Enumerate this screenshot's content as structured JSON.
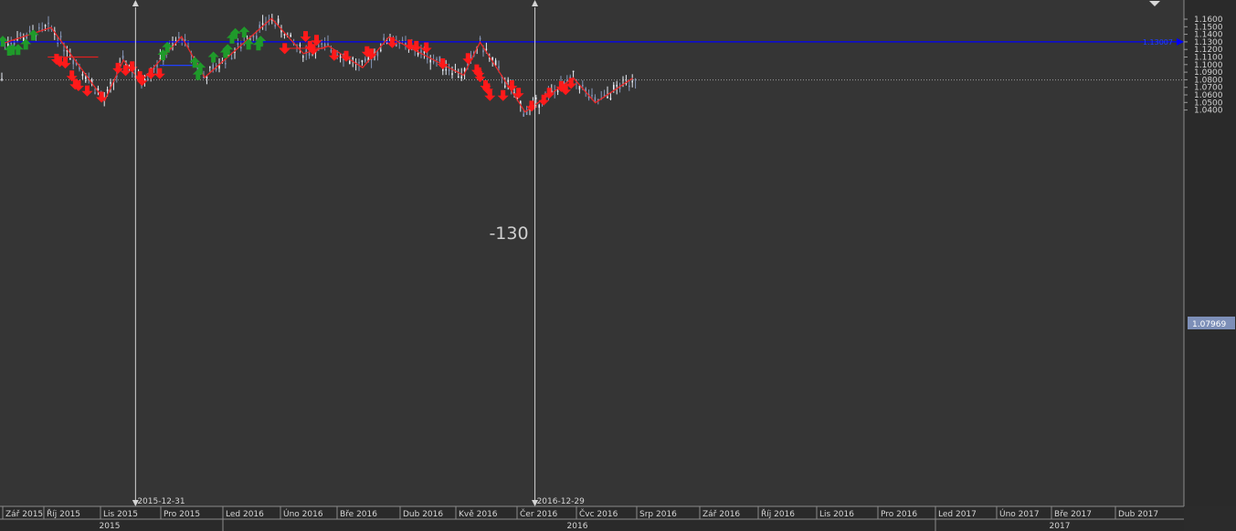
{
  "chart_data": {
    "type": "candlestick",
    "instrument_hint": "EUR/USD-style price series",
    "y_axis": {
      "ticks": [
        1.16,
        1.15,
        1.14,
        1.13,
        1.12,
        1.11,
        1.1,
        1.09,
        1.08,
        1.07,
        1.06,
        1.05,
        1.04
      ],
      "tick_labels": [
        "1.1600",
        "1.1500",
        "1.1400",
        "1.1300",
        "1.1200",
        "1.1100",
        "1.1000",
        "1.0900",
        "1.0800",
        "1.0700",
        "1.0600",
        "1.0500",
        "1.0400"
      ],
      "range": [
        1.033,
        1.1655
      ]
    },
    "x_axis": {
      "month_labels": [
        "Zář 2015",
        "Říj 2015",
        "Lis 2015",
        "Pro 2015",
        "Led 2016",
        "Úno 2016",
        "Bře 2016",
        "Dub 2016",
        "Kvě 2016",
        "Čer 2016",
        "Čvc 2016",
        "Srp 2016",
        "Zář 2016",
        "Říj 2016",
        "Lis 2016",
        "Pro 2016",
        "Led 2017",
        "Úno 2017",
        "Bře 2017",
        "Dub 2017"
      ],
      "year_labels": [
        "2015",
        "2016",
        "2017"
      ]
    },
    "horizontal_line": {
      "value": 1.13,
      "label": "1.13007",
      "color": "#0000ff"
    },
    "current_price": {
      "value": 1.0797,
      "label": "1.07969"
    },
    "vertical_markers": [
      {
        "date": "2015-12-31",
        "label": "2015-12-31"
      },
      {
        "date": "2016-12-29",
        "label": "2016-12-29"
      }
    ],
    "annotation": "-130",
    "zigzag": [
      {
        "date": "2015-09-01",
        "price": 1.128
      },
      {
        "date": "2015-10-15",
        "price": 1.149
      },
      {
        "date": "2015-12-03",
        "price": 1.0525
      },
      {
        "date": "2015-12-20",
        "price": 1.106
      },
      {
        "date": "2016-01-05",
        "price": 1.0775
      },
      {
        "date": "2016-02-11",
        "price": 1.137
      },
      {
        "date": "2016-03-03",
        "price": 1.083
      },
      {
        "date": "2016-05-03",
        "price": 1.161
      },
      {
        "date": "2016-06-01",
        "price": 1.1145
      },
      {
        "date": "2016-06-24",
        "price": 1.1245
      },
      {
        "date": "2016-07-25",
        "price": 1.096
      },
      {
        "date": "2016-08-18",
        "price": 1.1365
      },
      {
        "date": "2016-10-25",
        "price": 1.086
      },
      {
        "date": "2016-11-09",
        "price": 1.1295
      },
      {
        "date": "2016-12-20",
        "price": 1.0375
      },
      {
        "date": "2017-02-02",
        "price": 1.0825
      },
      {
        "date": "2017-02-22",
        "price": 1.0495
      },
      {
        "date": "2017-03-28",
        "price": 1.082
      }
    ],
    "buy_signals": [
      {
        "date": "2015-09-01",
        "price": 1.131
      },
      {
        "date": "2015-09-07",
        "price": 1.119
      },
      {
        "date": "2015-09-10",
        "price": 1.12
      },
      {
        "date": "2015-09-15",
        "price": 1.12
      },
      {
        "date": "2015-09-22",
        "price": 1.127
      },
      {
        "date": "2015-09-29",
        "price": 1.139
      },
      {
        "date": "2016-01-25",
        "price": 1.113
      },
      {
        "date": "2016-01-29",
        "price": 1.123
      },
      {
        "date": "2016-02-23",
        "price": 1.103
      },
      {
        "date": "2016-02-26",
        "price": 1.087
      },
      {
        "date": "2016-02-28",
        "price": 1.096
      },
      {
        "date": "2016-03-11",
        "price": 1.11
      },
      {
        "date": "2016-03-22",
        "price": 1.116
      },
      {
        "date": "2016-03-24",
        "price": 1.12
      },
      {
        "date": "2016-03-28",
        "price": 1.135
      },
      {
        "date": "2016-03-31",
        "price": 1.141
      },
      {
        "date": "2016-04-08",
        "price": 1.143
      },
      {
        "date": "2016-04-12",
        "price": 1.127
      },
      {
        "date": "2016-04-21",
        "price": 1.126
      },
      {
        "date": "2016-04-23",
        "price": 1.131
      }
    ],
    "sell_signals": [
      {
        "date": "2015-10-20",
        "price": 1.107
      },
      {
        "date": "2015-10-23",
        "price": 1.104
      },
      {
        "date": "2015-10-28",
        "price": 1.102
      },
      {
        "date": "2015-11-03",
        "price": 1.085
      },
      {
        "date": "2015-11-06",
        "price": 1.074
      },
      {
        "date": "2015-11-09",
        "price": 1.072
      },
      {
        "date": "2015-11-17",
        "price": 1.065
      },
      {
        "date": "2015-11-30",
        "price": 1.057
      },
      {
        "date": "2015-12-15",
        "price": 1.095
      },
      {
        "date": "2015-12-22",
        "price": 1.092
      },
      {
        "date": "2015-12-28",
        "price": 1.097
      },
      {
        "date": "2016-01-04",
        "price": 1.084
      },
      {
        "date": "2016-01-06",
        "price": 1.079
      },
      {
        "date": "2016-01-14",
        "price": 1.088
      },
      {
        "date": "2016-01-22",
        "price": 1.088
      },
      {
        "date": "2016-05-15",
        "price": 1.121
      },
      {
        "date": "2016-06-03",
        "price": 1.137
      },
      {
        "date": "2016-06-07",
        "price": 1.124
      },
      {
        "date": "2016-06-10",
        "price": 1.12
      },
      {
        "date": "2016-06-13",
        "price": 1.132
      },
      {
        "date": "2016-06-29",
        "price": 1.112
      },
      {
        "date": "2016-07-10",
        "price": 1.111
      },
      {
        "date": "2016-07-29",
        "price": 1.117
      },
      {
        "date": "2016-08-02",
        "price": 1.114
      },
      {
        "date": "2016-08-21",
        "price": 1.129
      },
      {
        "date": "2016-09-06",
        "price": 1.126
      },
      {
        "date": "2016-09-12",
        "price": 1.124
      },
      {
        "date": "2016-09-21",
        "price": 1.122
      },
      {
        "date": "2016-10-06",
        "price": 1.101
      },
      {
        "date": "2016-10-29",
        "price": 1.108
      },
      {
        "date": "2016-11-06",
        "price": 1.093
      },
      {
        "date": "2016-11-08",
        "price": 1.089
      },
      {
        "date": "2016-11-09",
        "price": 1.084
      },
      {
        "date": "2016-11-14",
        "price": 1.072
      },
      {
        "date": "2016-11-16",
        "price": 1.068
      },
      {
        "date": "2016-11-18",
        "price": 1.059
      },
      {
        "date": "2016-11-30",
        "price": 1.059
      },
      {
        "date": "2016-12-08",
        "price": 1.072
      },
      {
        "date": "2016-12-14",
        "price": 1.062
      },
      {
        "date": "2016-12-26",
        "price": 1.045
      },
      {
        "date": "2017-01-06",
        "price": 1.053
      },
      {
        "date": "2017-01-11",
        "price": 1.062
      },
      {
        "date": "2017-01-22",
        "price": 1.071
      },
      {
        "date": "2017-01-26",
        "price": 1.067
      },
      {
        "date": "2017-01-31",
        "price": 1.075
      }
    ],
    "support_resistance_segments": [
      {
        "date_from": "2015-10-12",
        "date_to": "2015-11-27",
        "price": 1.11,
        "color": "#e02020"
      },
      {
        "date_from": "2016-01-22",
        "date_to": "2016-02-21",
        "price": 1.099,
        "color": "#2040ff"
      },
      {
        "date_from": "2016-05-10",
        "date_to": "2016-06-21",
        "price": 1.1215,
        "color": "#e02020"
      }
    ],
    "grid": false
  }
}
